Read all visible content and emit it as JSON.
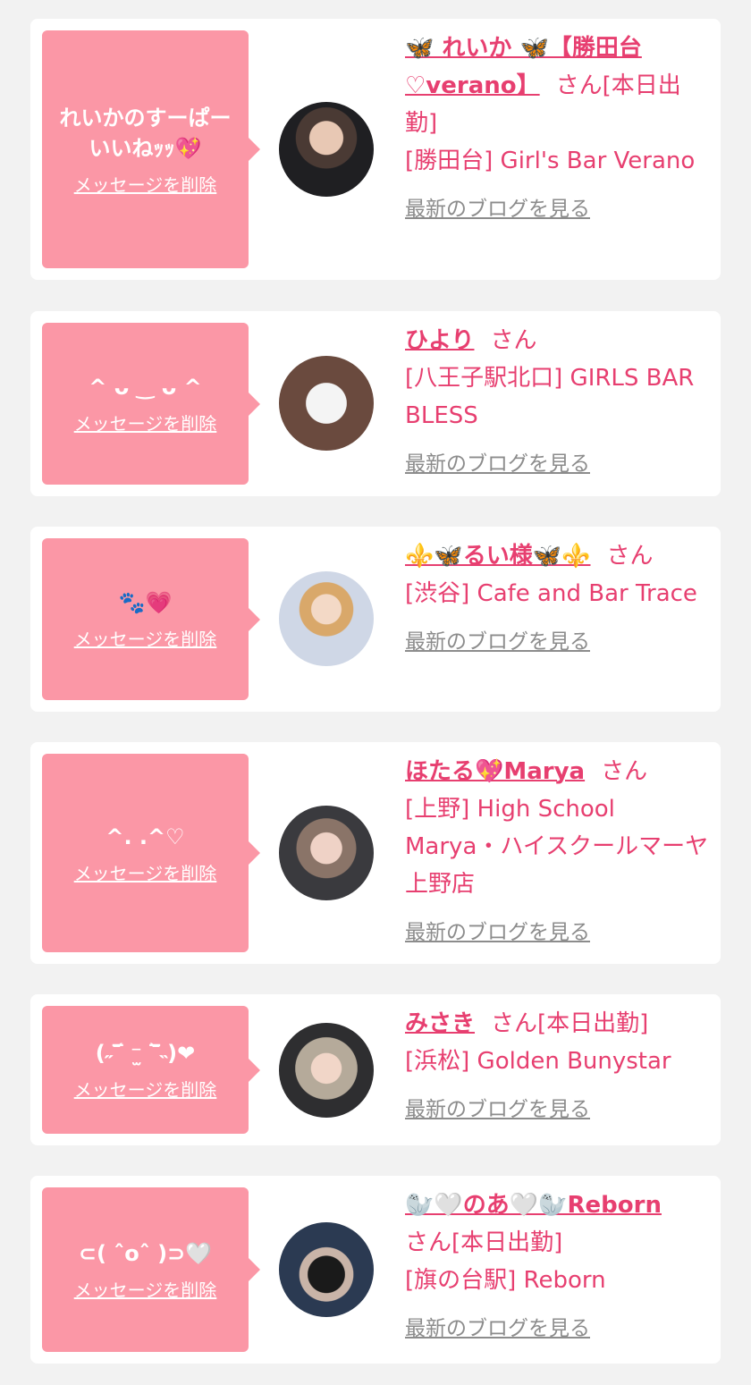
{
  "delete_label": "メッセージを削除",
  "blog_label": "最新のブログを見る",
  "colors": {
    "accent": "#e73f70",
    "bubble": "#fb97a6",
    "muted": "#8c8c8c",
    "background": "#f2f2f2"
  },
  "items": [
    {
      "message": "れいかのすーぱーいいねｯｯ💖",
      "name": "🦋 れいか 🦋【勝田台♡verano】",
      "suffix": "さん[本日出勤]",
      "shop": "[勝田台] Girl's Bar Verano"
    },
    {
      "message": "^ ᴗ ‿ ᴗ ^",
      "name": "ひより",
      "suffix": "さん",
      "shop": "[八王子駅北口] GIRLS BAR BLESS"
    },
    {
      "message": "🐾💗",
      "name": "⚜️🦋るい様🦋⚜️",
      "suffix": "さん",
      "shop": "[渋谷] Cafe and Bar Trace"
    },
    {
      "message": "^. .^♡",
      "name": "ほたる💖Marya",
      "suffix": "さん",
      "shop": "[上野] High School Marya・ハイスクールマーヤ上野店"
    },
    {
      "message": "(˶‾᷄ ⁻̫ ‾᷅˵)❤",
      "name": "みさき",
      "suffix": "さん[本日出勤]",
      "shop": "[浜松] Golden Bunystar"
    },
    {
      "message": "⊂( ˆoˆ )⊃🤍",
      "name": "🦭🤍のあ🤍🦭Reborn",
      "suffix": "さん[本日出勤]",
      "shop": "[旗の台駅] Reborn"
    }
  ]
}
